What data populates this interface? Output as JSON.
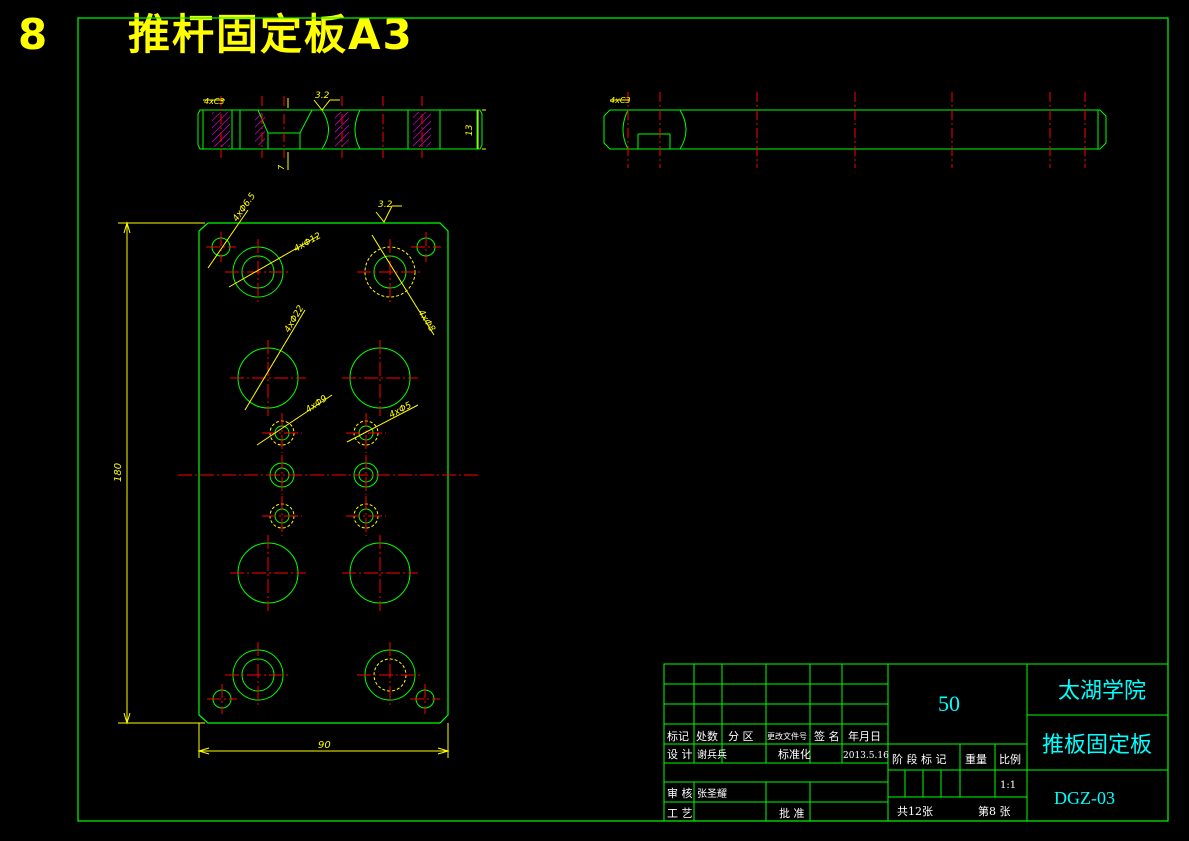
{
  "header": {
    "number": "8",
    "title": "推杆固定板A3"
  },
  "section_view": {
    "chamfer_left": "4xC3",
    "roughness": "3.2",
    "thickness": "13",
    "counterbore_depth": "7"
  },
  "side_view": {
    "chamfer": "4xC3"
  },
  "plan_view": {
    "roughness": "3.2",
    "dims": {
      "height": "180",
      "width": "90",
      "hole_a": "4xΦ6.5",
      "hole_b": "4xΦ12",
      "hole_c": "4xΦ8",
      "hole_d": "4xΦ22",
      "hole_e": "4xΦ9",
      "hole_f": "4xΦ5"
    }
  },
  "title_block": {
    "material": "50",
    "school": "太湖学院",
    "part_name": "推板固定板",
    "drawing_no": "DGZ-03",
    "hdr_mark": "标记",
    "hdr_count": "处数",
    "hdr_zone": "分 区",
    "hdr_change_doc": "更改文件号",
    "hdr_sign": "签 名",
    "hdr_date": "年月日",
    "designer_label": "设 计",
    "designer": "谢兵兵",
    "standard_label": "标准化",
    "date": "2013.5.16",
    "stage_label": "阶 段 标 记",
    "weight_label": "重量",
    "scale_label": "比例",
    "scale": "1:1",
    "checker_label": "审 核",
    "checker": "张圣耀",
    "process_label": "工 艺",
    "approve_label": "批 准",
    "sheets_total": "共12张",
    "sheet_no": "第8 张"
  },
  "colors": {
    "outline": "#00ff00",
    "centerline": "#ff0000",
    "dimension": "#ffff00",
    "hatch": "#ff00ff",
    "tb_text": "#00ffff"
  }
}
